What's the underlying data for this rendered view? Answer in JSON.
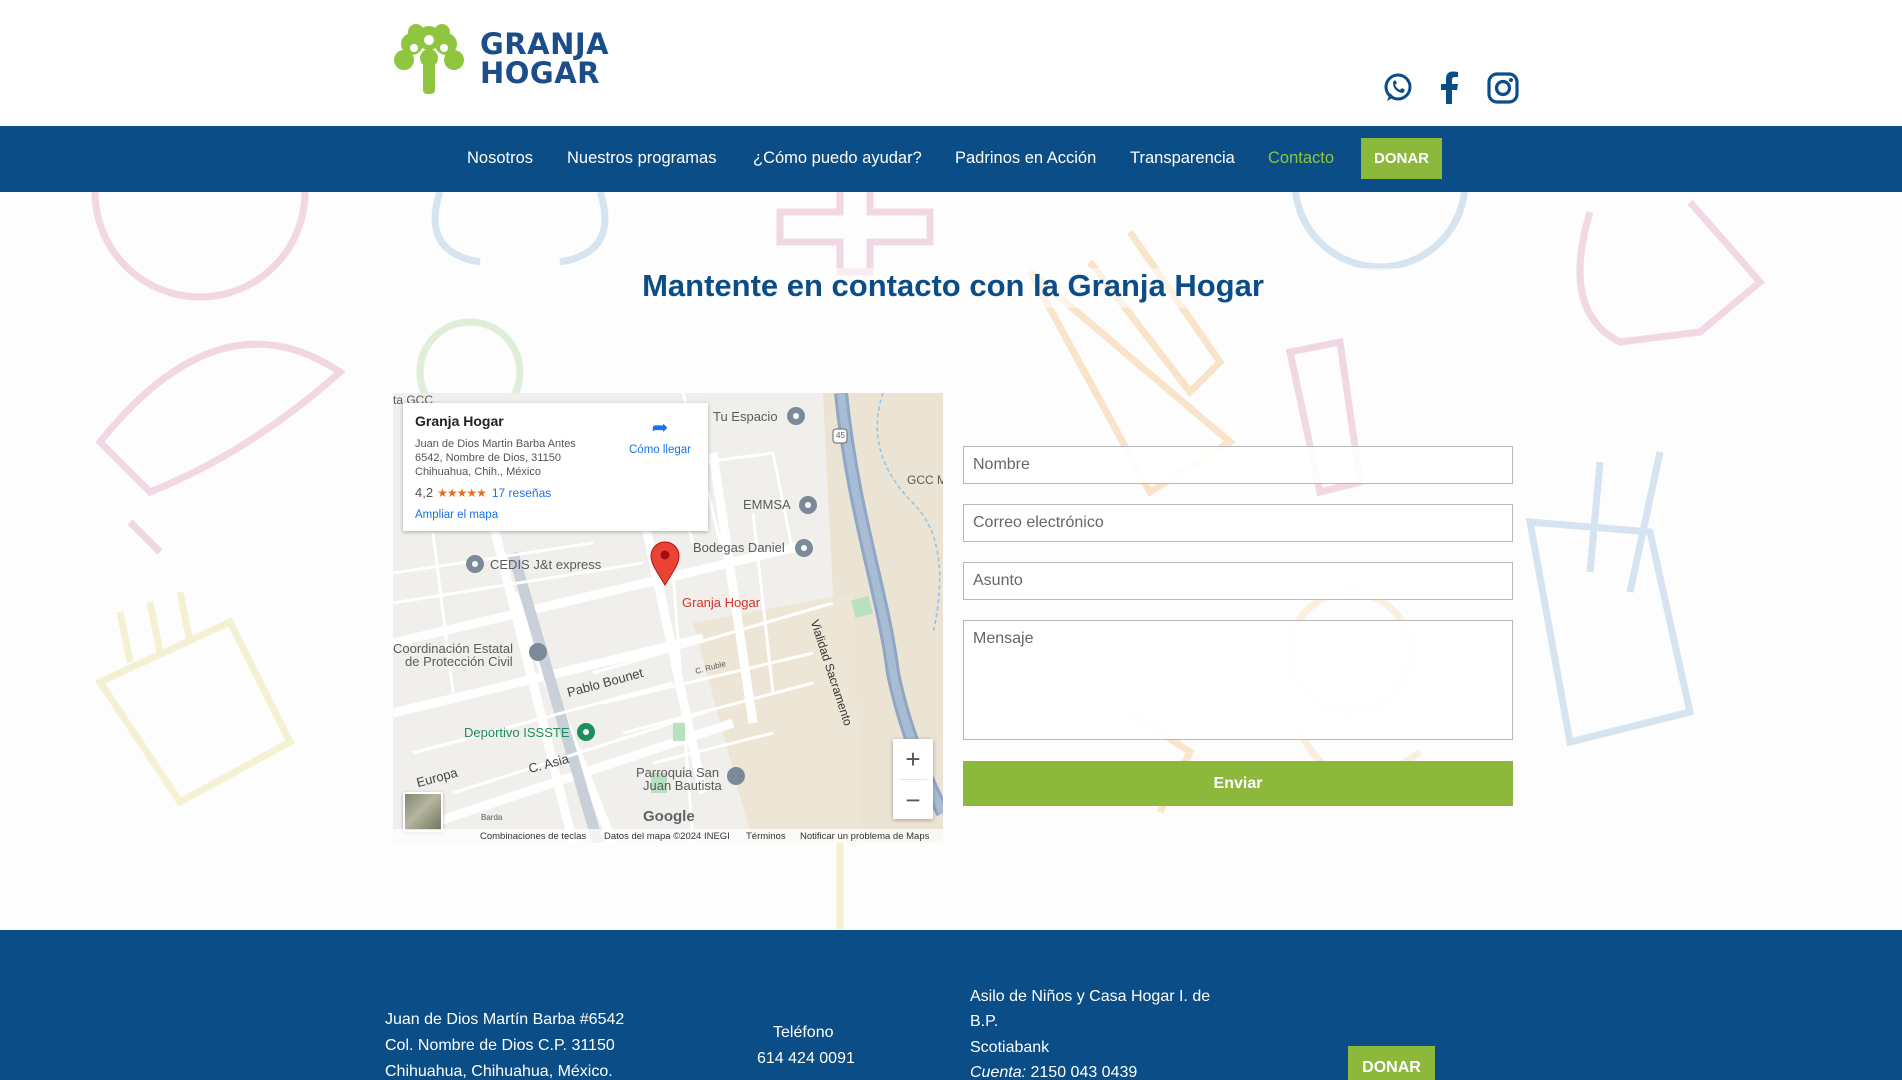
{
  "brand": {
    "logo_line1": "GRANJA",
    "logo_line2": "HOGAR",
    "green": "#8ec63f",
    "blue": "#0b4d86"
  },
  "social": [
    {
      "name": "whatsapp-icon"
    },
    {
      "name": "facebook-icon"
    },
    {
      "name": "instagram-icon"
    }
  ],
  "nav": {
    "items": [
      "Nosotros",
      "Nuestros programas",
      "¿Cómo puedo ayudar?",
      "Padrinos en Acción",
      "Transparencia",
      "Contacto"
    ],
    "active": "Contacto",
    "donate": "DONAR"
  },
  "page": {
    "title": "Mantente en contacto con la Granja Hogar"
  },
  "map": {
    "place_name": "Granja Hogar",
    "address": "Juan de Dios Martin Barba Antes 6542, Nombre de Dios, 31150 Chihuahua, Chih., México",
    "rating": "4,2",
    "stars": "★★★★★",
    "reviews": "17 reseñas",
    "enlarge": "Ampliar el mapa",
    "directions": "Cómo llegar",
    "labels": {
      "tu_espacio": "Tu Espacio",
      "emmsa": "EMMSA",
      "bodegas": "Bodegas Daniel",
      "cedis": "CEDIS J&t express",
      "pin": "Granja Hogar",
      "coordinacion1": "Coordinación Estatal",
      "coordinacion2": "de Protección Civil",
      "pablo": "Pablo Bounet",
      "deportivo": "Deportivo ISSSTE",
      "europa": "Europa",
      "asia": "C. Asia",
      "parroquia1": "Parroquia San",
      "parroquia2": "Juan Bautista",
      "vialidad": "Vialidad Sacramento",
      "gcc": "GCC M",
      "gcc_top": "ta GCC",
      "ruble": "C. Ruble",
      "highway": "45",
      "barda": "Barda"
    },
    "footer": [
      "Combinaciones de teclas",
      "Datos del mapa ©2024 INEGI",
      "Términos",
      "Notificar un problema de Maps"
    ],
    "google": "Google"
  },
  "form": {
    "name_placeholder": "Nombre",
    "email_placeholder": "Correo electrónico",
    "subject_placeholder": "Asunto",
    "message_placeholder": "Mensaje",
    "submit": "Enviar"
  },
  "footer": {
    "address1": "Juan de Dios Martín Barba #6542",
    "address2": "Col. Nombre de Dios C.P. 31150",
    "address3": "Chihuahua, Chihuahua, México.",
    "phone_label": "Teléfono",
    "phone": "614 424 0091",
    "org1": "Asilo de Niños y Casa Hogar I. de",
    "org2": "B.P.",
    "bank": "Scotiabank",
    "account_label": "Cuenta:",
    "account": "2150 043 0439",
    "donate": "DONAR"
  }
}
